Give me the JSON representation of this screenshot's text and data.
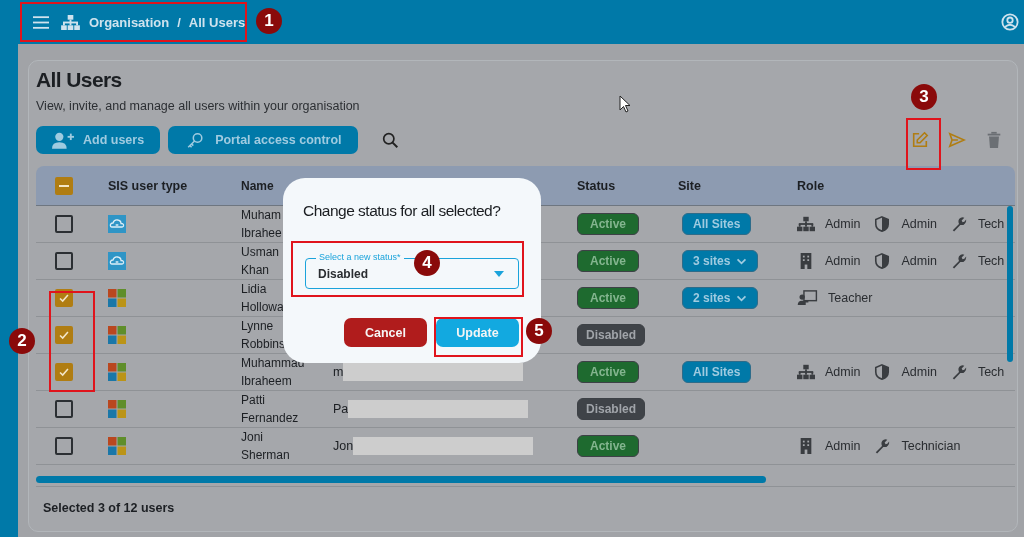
{
  "breadcrumb": {
    "items": [
      "Organisation",
      "All Users"
    ],
    "separator": "/"
  },
  "page": {
    "title": "All Users",
    "subtitle": "View, invite, and manage all users within your organisation"
  },
  "actions": [
    {
      "label": "Add users",
      "kind": "add"
    },
    {
      "label": "Portal access control",
      "kind": "key"
    }
  ],
  "toolbar": [
    {
      "kind": "edit",
      "disabled": false
    },
    {
      "kind": "send",
      "disabled": false
    },
    {
      "kind": "delete",
      "disabled": true
    }
  ],
  "table": {
    "select_all": {
      "indeterminate": true
    },
    "columns": [
      {
        "label": "SIS user type"
      },
      {
        "label": "Name"
      },
      {
        "label": "Status"
      },
      {
        "label": "Site"
      },
      {
        "label": "Role"
      }
    ],
    "rows": [
      {
        "checked": false,
        "sis_user_type": {
          "kind": "cloud"
        },
        "name": [
          "Muham",
          "Ibrahee"
        ],
        "status": {
          "label": "Active",
          "kind": "active"
        },
        "site": {
          "label": "All Sites",
          "dropdown": false
        },
        "roles": [
          {
            "kind": "org",
            "label": "Admin"
          },
          {
            "kind": "shield",
            "label": "Admin"
          },
          {
            "kind": "wrench",
            "label": "Tech"
          }
        ]
      },
      {
        "checked": false,
        "sis_user_type": {
          "kind": "cloud"
        },
        "name": [
          "Usman",
          "Khan"
        ],
        "status": {
          "label": "Active",
          "kind": "active"
        },
        "site": {
          "label": "3 sites",
          "dropdown": true
        },
        "roles": [
          {
            "kind": "building",
            "label": "Admin"
          },
          {
            "kind": "shield",
            "label": "Admin"
          },
          {
            "kind": "wrench",
            "label": "Tech"
          }
        ]
      },
      {
        "checked": true,
        "sis_user_type": {
          "kind": "windows"
        },
        "name": [
          "Lidia",
          "Hollowa"
        ],
        "status": {
          "label": "Active",
          "kind": "active"
        },
        "site": {
          "label": "2 sites",
          "dropdown": true
        },
        "roles": [
          {
            "kind": "teacher",
            "label": "Teacher"
          }
        ]
      },
      {
        "checked": true,
        "sis_user_type": {
          "kind": "windows"
        },
        "name": [
          "Lynne",
          "Robbins"
        ],
        "status": {
          "label": "Disabled",
          "kind": "disabled"
        }
      },
      {
        "checked": true,
        "sis_user_type": {
          "kind": "windows"
        },
        "name": [
          "Muhammad",
          "Ibraheem"
        ],
        "column_4": {
          "text": "m",
          "redacted": true
        },
        "status": {
          "label": "Active",
          "kind": "active"
        },
        "site": {
          "label": "All Sites",
          "dropdown": false
        },
        "roles": [
          {
            "kind": "org",
            "label": "Admin"
          },
          {
            "kind": "shield",
            "label": "Admin"
          },
          {
            "kind": "wrench",
            "label": "Tech"
          }
        ]
      },
      {
        "checked": false,
        "sis_user_type": {
          "kind": "windows"
        },
        "name": [
          "Patti",
          "Fernandez"
        ],
        "column_4": {
          "text": "Pa",
          "redacted": true
        },
        "status": {
          "label": "Disabled",
          "kind": "disabled"
        }
      },
      {
        "checked": false,
        "sis_user_type": {
          "kind": "windows"
        },
        "name": [
          "Joni",
          "Sherman"
        ],
        "column_4": {
          "text": "Jon",
          "redacted": true
        },
        "status": {
          "label": "Active",
          "kind": "active"
        },
        "roles": [
          {
            "kind": "building",
            "label": "Admin"
          },
          {
            "kind": "wrench",
            "label": "Technician"
          }
        ]
      }
    ]
  },
  "footer": {
    "text": "Selected 3 of 12 users"
  },
  "dialog": {
    "title": "Change status for all selected?",
    "select": {
      "label": "Select a new status*",
      "value": "Disabled"
    },
    "buttons": [
      {
        "label": "Cancel",
        "kind": "cancel"
      },
      {
        "label": "Update",
        "kind": "confirm"
      }
    ]
  },
  "annotations": [
    "1",
    "2",
    "3",
    "4",
    "5"
  ]
}
